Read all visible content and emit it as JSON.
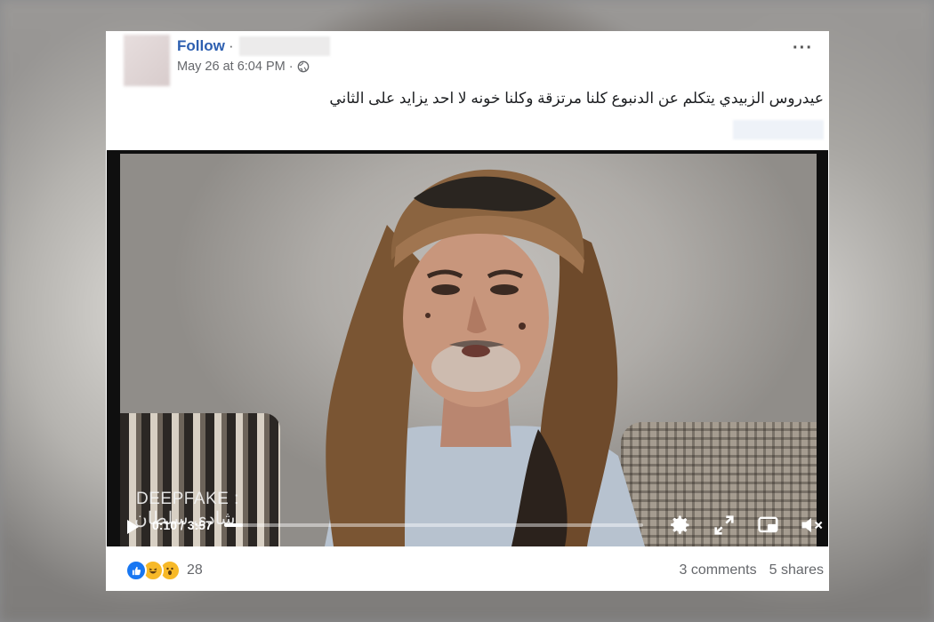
{
  "post": {
    "follow_label": "Follow",
    "separator": "·",
    "timestamp": "May 26 at 6:04 PM",
    "meta_separator": "·",
    "audience_icon": "globe-icon",
    "more_icon": "more-options-icon",
    "caption": "عيدروس الزبيدي يتكلم عن الدنبوع كلنا مرتزقة وكلنا خونه لا احد يزايد على الثاني"
  },
  "video": {
    "watermark_line1": "DEEPFAKE :",
    "watermark_line2": "شادي سلطان",
    "current_time": "0:10",
    "duration": "3:57",
    "time_display": "0:10 / 3:57",
    "progress_fraction": 0.044,
    "icons": [
      "play-icon",
      "settings-icon",
      "fullscreen-icon",
      "picture-in-picture-icon",
      "muted-volume-icon"
    ]
  },
  "engagement": {
    "reaction_icons": [
      "like-icon",
      "haha-icon",
      "wow-icon"
    ],
    "reaction_count": "28",
    "comments": "3 comments",
    "shares": "5 shares"
  },
  "colors": {
    "follow_link": "#2d5fb0",
    "like_blue": "#1877f2",
    "reaction_yellow": "#f7b928"
  }
}
